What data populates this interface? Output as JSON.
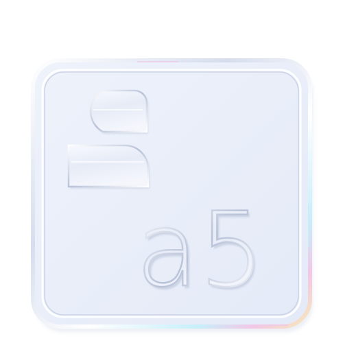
{
  "icon": {
    "name": "a5 app icon",
    "text": "a5",
    "colors": {
      "tile_fill": "#e9eef9",
      "tile_inner": "#eef2fb",
      "rim_light": "#ffffff",
      "rim_shadow": "#b9c3d8",
      "glyph_highlight": "#ffffff",
      "glyph_shadow": "#aeb9d0",
      "iridescent_pink": "#f3c6e6",
      "iridescent_cyan": "#c7eefa",
      "iridescent_yellow": "#f6eab8"
    }
  }
}
